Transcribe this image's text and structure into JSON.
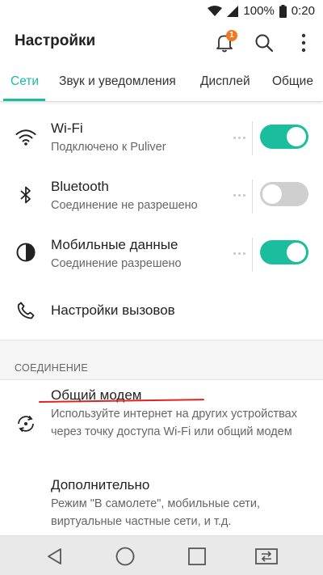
{
  "status_bar": {
    "battery": "100%",
    "time": "0:20"
  },
  "app_bar": {
    "title": "Настройки",
    "notification_count": "1",
    "icons": [
      "bell-icon",
      "search-icon",
      "more-vert-icon"
    ]
  },
  "tabs": [
    {
      "label": "Сети",
      "active": true
    },
    {
      "label": "Звук и уведомления",
      "active": false
    },
    {
      "label": "Дисплей",
      "active": false
    },
    {
      "label": "Общие",
      "active": false
    }
  ],
  "network_items": [
    {
      "icon": "wifi-icon",
      "title": "Wi-Fi",
      "subtitle": "Подключено к Puliver",
      "toggle": "on"
    },
    {
      "icon": "bluetooth-icon",
      "title": "Bluetooth",
      "subtitle": "Соединение не разрешено",
      "toggle": "off"
    },
    {
      "icon": "mobile-data-icon",
      "title": "Мобильные данные",
      "subtitle": "Соединение разрешено",
      "toggle": "on"
    },
    {
      "icon": "phone-icon",
      "title": "Настройки вызовов"
    }
  ],
  "connection_section": {
    "header": "СОЕДИНЕНИЕ",
    "items": [
      {
        "icon": "tethering-icon",
        "title": "Общий модем",
        "subtitle": "Используйте интернет на других устройствах через точку доступа Wi-Fi или общий модем"
      },
      {
        "title": "Дополнительно",
        "subtitle": "Режим \"В самолете\", мобильные сети, виртуальные частные сети, и т.д."
      }
    ]
  },
  "nav_bar": {
    "icons": [
      "back-icon",
      "home-icon",
      "recents-icon",
      "dual-window-icon"
    ]
  },
  "colors": {
    "accent": "#1bbd9f",
    "badge": "#f5771f",
    "annotation": "#e0231d"
  }
}
